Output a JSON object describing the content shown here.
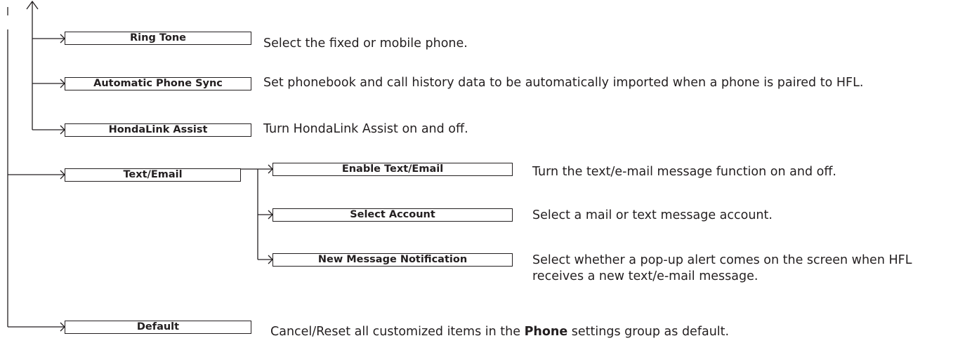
{
  "items": {
    "ring_tone": {
      "label": "Ring Tone",
      "description": "Select the fixed or mobile phone."
    },
    "automatic_phone_sync": {
      "label": "Automatic Phone Sync",
      "description": "Set phonebook and call history data to be automatically imported when a phone is paired to HFL."
    },
    "hondalink_assist": {
      "label": "HondaLink Assist",
      "description": "Turn HondaLink Assist on and off."
    },
    "text_email": {
      "label": "Text/Email"
    },
    "enable_text_email": {
      "label": "Enable Text/Email",
      "description": "Turn the text/e-mail message function on and off."
    },
    "select_account": {
      "label": "Select Account",
      "description": "Select a mail or text message account."
    },
    "new_message_notification": {
      "label": "New Message Notification",
      "description_line1": "Select whether a pop-up alert comes on the screen when HFL",
      "description_line2": "receives a new text/e-mail message."
    },
    "default": {
      "label": "Default",
      "description_prefix": "Cancel/Reset all customized items in the ",
      "description_bold": "Phone",
      "description_suffix": " settings group as default."
    }
  }
}
